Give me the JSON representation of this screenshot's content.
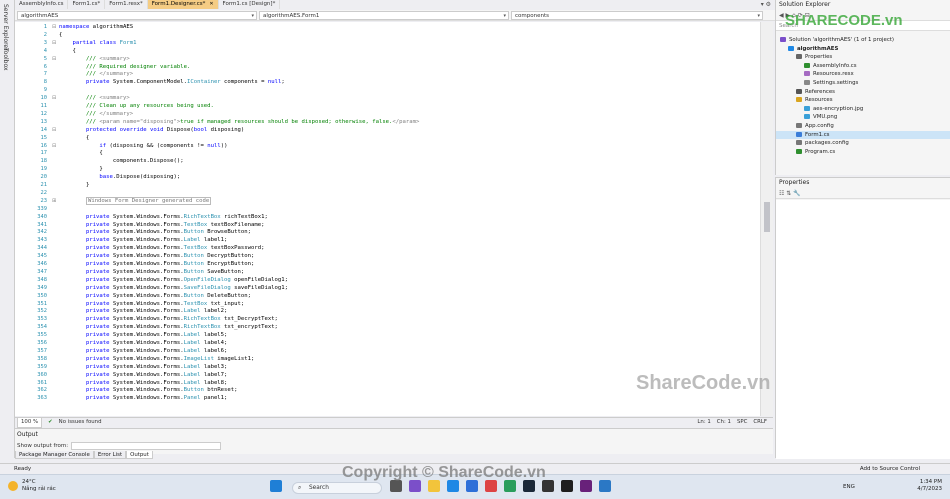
{
  "left_bar": {
    "server_explorer": "Server Explorer",
    "toolbox": "Toolbox"
  },
  "tabs": [
    {
      "label": "AssemblyInfo.cs",
      "close": ""
    },
    {
      "label": "Form1.cs*",
      "close": ""
    },
    {
      "label": "Form1.resx*",
      "close": ""
    },
    {
      "label": "Form1.Designer.cs*",
      "close": "✕"
    },
    {
      "label": "Form1.cs [Design]*",
      "close": ""
    }
  ],
  "navbar": {
    "project": "algorithmAES",
    "class": "algorithmAES.Form1",
    "member": "components"
  },
  "code_lines": [
    {
      "n": "1",
      "t": "namespace algorithmAES",
      "k": "ns"
    },
    {
      "n": "2",
      "t": "{"
    },
    {
      "n": "3",
      "t": "    partial class Form1",
      "k": "cls"
    },
    {
      "n": "4",
      "t": "    {"
    },
    {
      "n": "5",
      "t": "        /// <summary>",
      "k": "cm"
    },
    {
      "n": "6",
      "t": "        /// Required designer variable.",
      "k": "cm"
    },
    {
      "n": "7",
      "t": "        /// </summary>",
      "k": "cm"
    },
    {
      "n": "8",
      "t": "        private System.ComponentModel.IContainer components = null;",
      "k": "priv"
    },
    {
      "n": "9",
      "t": ""
    },
    {
      "n": "10",
      "t": "        /// <summary>",
      "k": "cm"
    },
    {
      "n": "11",
      "t": "        /// Clean up any resources being used.",
      "k": "cm"
    },
    {
      "n": "12",
      "t": "        /// </summary>",
      "k": "cm"
    },
    {
      "n": "13",
      "t": "        /// <param name=\"disposing\">true if managed resources should be disposed; otherwise, false.</param>",
      "k": "cm"
    },
    {
      "n": "14",
      "t": "        protected override void Dispose(bool disposing)",
      "k": "prot"
    },
    {
      "n": "15",
      "t": "        {"
    },
    {
      "n": "16",
      "t": "            if (disposing && (components != null))",
      "k": "if"
    },
    {
      "n": "17",
      "t": "            {"
    },
    {
      "n": "18",
      "t": "                components.Dispose();"
    },
    {
      "n": "19",
      "t": "            }"
    },
    {
      "n": "20",
      "t": "            base.Dispose(disposing);",
      "k": "base"
    },
    {
      "n": "21",
      "t": "        }"
    },
    {
      "n": "22",
      "t": ""
    },
    {
      "n": "23",
      "t": "        Windows Form Designer generated code",
      "k": "region"
    },
    {
      "n": "339",
      "t": ""
    },
    {
      "n": "340",
      "t": "        private System.Windows.Forms.RichTextBox richTextBox1;",
      "k": "f"
    },
    {
      "n": "341",
      "t": "        private System.Windows.Forms.TextBox textBoxFilename;",
      "k": "f"
    },
    {
      "n": "342",
      "t": "        private System.Windows.Forms.Button BrowseButton;",
      "k": "f"
    },
    {
      "n": "343",
      "t": "        private System.Windows.Forms.Label label1;",
      "k": "f"
    },
    {
      "n": "344",
      "t": "        private System.Windows.Forms.TextBox textBoxPassword;",
      "k": "f"
    },
    {
      "n": "345",
      "t": "        private System.Windows.Forms.Button DecryptButton;",
      "k": "f"
    },
    {
      "n": "346",
      "t": "        private System.Windows.Forms.Button EncryptButton;",
      "k": "f"
    },
    {
      "n": "347",
      "t": "        private System.Windows.Forms.Button SaveButton;",
      "k": "f"
    },
    {
      "n": "348",
      "t": "        private System.Windows.Forms.OpenFileDialog openFileDialog1;",
      "k": "f"
    },
    {
      "n": "349",
      "t": "        private System.Windows.Forms.SaveFileDialog saveFileDialog1;",
      "k": "f"
    },
    {
      "n": "350",
      "t": "        private System.Windows.Forms.Button DeleteButton;",
      "k": "f"
    },
    {
      "n": "351",
      "t": "        private System.Windows.Forms.TextBox txt_input;",
      "k": "f"
    },
    {
      "n": "352",
      "t": "        private System.Windows.Forms.Label label2;",
      "k": "f"
    },
    {
      "n": "353",
      "t": "        private System.Windows.Forms.RichTextBox txt_DecryptText;",
      "k": "f"
    },
    {
      "n": "354",
      "t": "        private System.Windows.Forms.RichTextBox txt_encryptText;",
      "k": "f"
    },
    {
      "n": "355",
      "t": "        private System.Windows.Forms.Label label5;",
      "k": "f"
    },
    {
      "n": "356",
      "t": "        private System.Windows.Forms.Label label4;",
      "k": "f"
    },
    {
      "n": "357",
      "t": "        private System.Windows.Forms.Label label6;",
      "k": "f"
    },
    {
      "n": "358",
      "t": "        private System.Windows.Forms.ImageList imageList1;",
      "k": "f"
    },
    {
      "n": "359",
      "t": "        private System.Windows.Forms.Label label3;",
      "k": "f"
    },
    {
      "n": "360",
      "t": "        private System.Windows.Forms.Label label7;",
      "k": "f"
    },
    {
      "n": "361",
      "t": "        private System.Windows.Forms.Label label8;",
      "k": "f"
    },
    {
      "n": "362",
      "t": "        private System.Windows.Forms.Button btnReset;",
      "k": "f"
    },
    {
      "n": "363",
      "t": "        private System.Windows.Forms.Panel panel1;",
      "k": "f"
    }
  ],
  "editor_status": {
    "zoom": "100 %",
    "issues": "No issues found",
    "ln": "Ln: 1",
    "ch": "Ch: 1",
    "spc": "SPC",
    "crlf": "CRLF"
  },
  "output": {
    "title": "Output",
    "show_from": "Show output from:",
    "tabs": [
      "Package Manager Console",
      "Error List",
      "Output"
    ]
  },
  "solution_explorer": {
    "title": "Solution Explorer",
    "search_placeholder": "Search",
    "items": [
      {
        "label": "Solution 'algorithmAES' (1 of 1 project)",
        "indent": 0,
        "icon": "solution"
      },
      {
        "label": "algorithmAES",
        "indent": 1,
        "icon": "project",
        "bold": true
      },
      {
        "label": "Properties",
        "indent": 2,
        "icon": "wrench"
      },
      {
        "label": "AssemblyInfo.cs",
        "indent": 3,
        "icon": "cs"
      },
      {
        "label": "Resources.resx",
        "indent": 3,
        "icon": "resx"
      },
      {
        "label": "Settings.settings",
        "indent": 3,
        "icon": "gear"
      },
      {
        "label": "References",
        "indent": 2,
        "icon": "ref"
      },
      {
        "label": "Resources",
        "indent": 2,
        "icon": "folder"
      },
      {
        "label": "aes-encryption.jpg",
        "indent": 3,
        "icon": "img"
      },
      {
        "label": "VMU.png",
        "indent": 3,
        "icon": "img"
      },
      {
        "label": "App.config",
        "indent": 2,
        "icon": "config"
      },
      {
        "label": "Form1.cs",
        "indent": 2,
        "icon": "form",
        "selected": true
      },
      {
        "label": "packages.config",
        "indent": 2,
        "icon": "config"
      },
      {
        "label": "Program.cs",
        "indent": 2,
        "icon": "cs"
      }
    ]
  },
  "properties": {
    "title": "Properties"
  },
  "status_bar": {
    "ready": "Ready",
    "add_source": "Add to Source Control"
  },
  "taskbar": {
    "temp": "24°C",
    "weather": "Nắng rải rác",
    "search": "Search",
    "lang": "ENG",
    "time": "1:34 PM",
    "date": "4/7/2023"
  },
  "watermarks": {
    "logo": "SHARECODE.vn",
    "mid": "ShareCode.vn",
    "copyright": "Copyright © ShareCode.vn"
  }
}
